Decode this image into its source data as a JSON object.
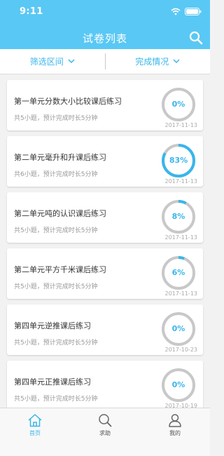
{
  "status_bar": {
    "time": "9:11"
  },
  "header": {
    "title": "试卷列表"
  },
  "filters": [
    {
      "label": "筛选区间"
    },
    {
      "label": "完成情况"
    }
  ],
  "colors": {
    "accent": "#39b6ea",
    "header": "#5ac8f4",
    "track": "#c8c8c8"
  },
  "exercises": [
    {
      "title": "第一单元分数大小比较课后练习",
      "subtitle": "共5小题，预计完成时长5分钟",
      "progress_label": "0%",
      "progress": 0,
      "date": "2017-11-13"
    },
    {
      "title": "第二单元毫升和升课后练习",
      "subtitle": "共6小题，预计完成时长5分钟",
      "progress_label": "83%",
      "progress": 0.83,
      "date": "2017-11-13"
    },
    {
      "title": "第二单元吨的认识课后练习",
      "subtitle": "共5小题，预计完成时长5分钟",
      "progress_label": "8%",
      "progress": 0.08,
      "date": "2017-11-13"
    },
    {
      "title": "第二单元平方千米课后练习",
      "subtitle": "共5小题，预计完成时长5分钟",
      "progress_label": "6%",
      "progress": 0.06,
      "date": "2017-11-13"
    },
    {
      "title": "第四单元逆推课后练习",
      "subtitle": "共5小题，预计完成时长5分钟",
      "progress_label": "0%",
      "progress": 0,
      "date": "2017-10-23"
    },
    {
      "title": "第四单元正推课后练习",
      "subtitle": "共5小题，预计完成时长5分钟",
      "progress_label": "0%",
      "progress": 0,
      "date": "2017-10-19"
    }
  ],
  "tabbar": [
    {
      "label": "首页",
      "icon": "home-icon",
      "active": true
    },
    {
      "label": "求助",
      "icon": "search-icon",
      "active": false
    },
    {
      "label": "我的",
      "icon": "user-icon",
      "active": false
    }
  ]
}
